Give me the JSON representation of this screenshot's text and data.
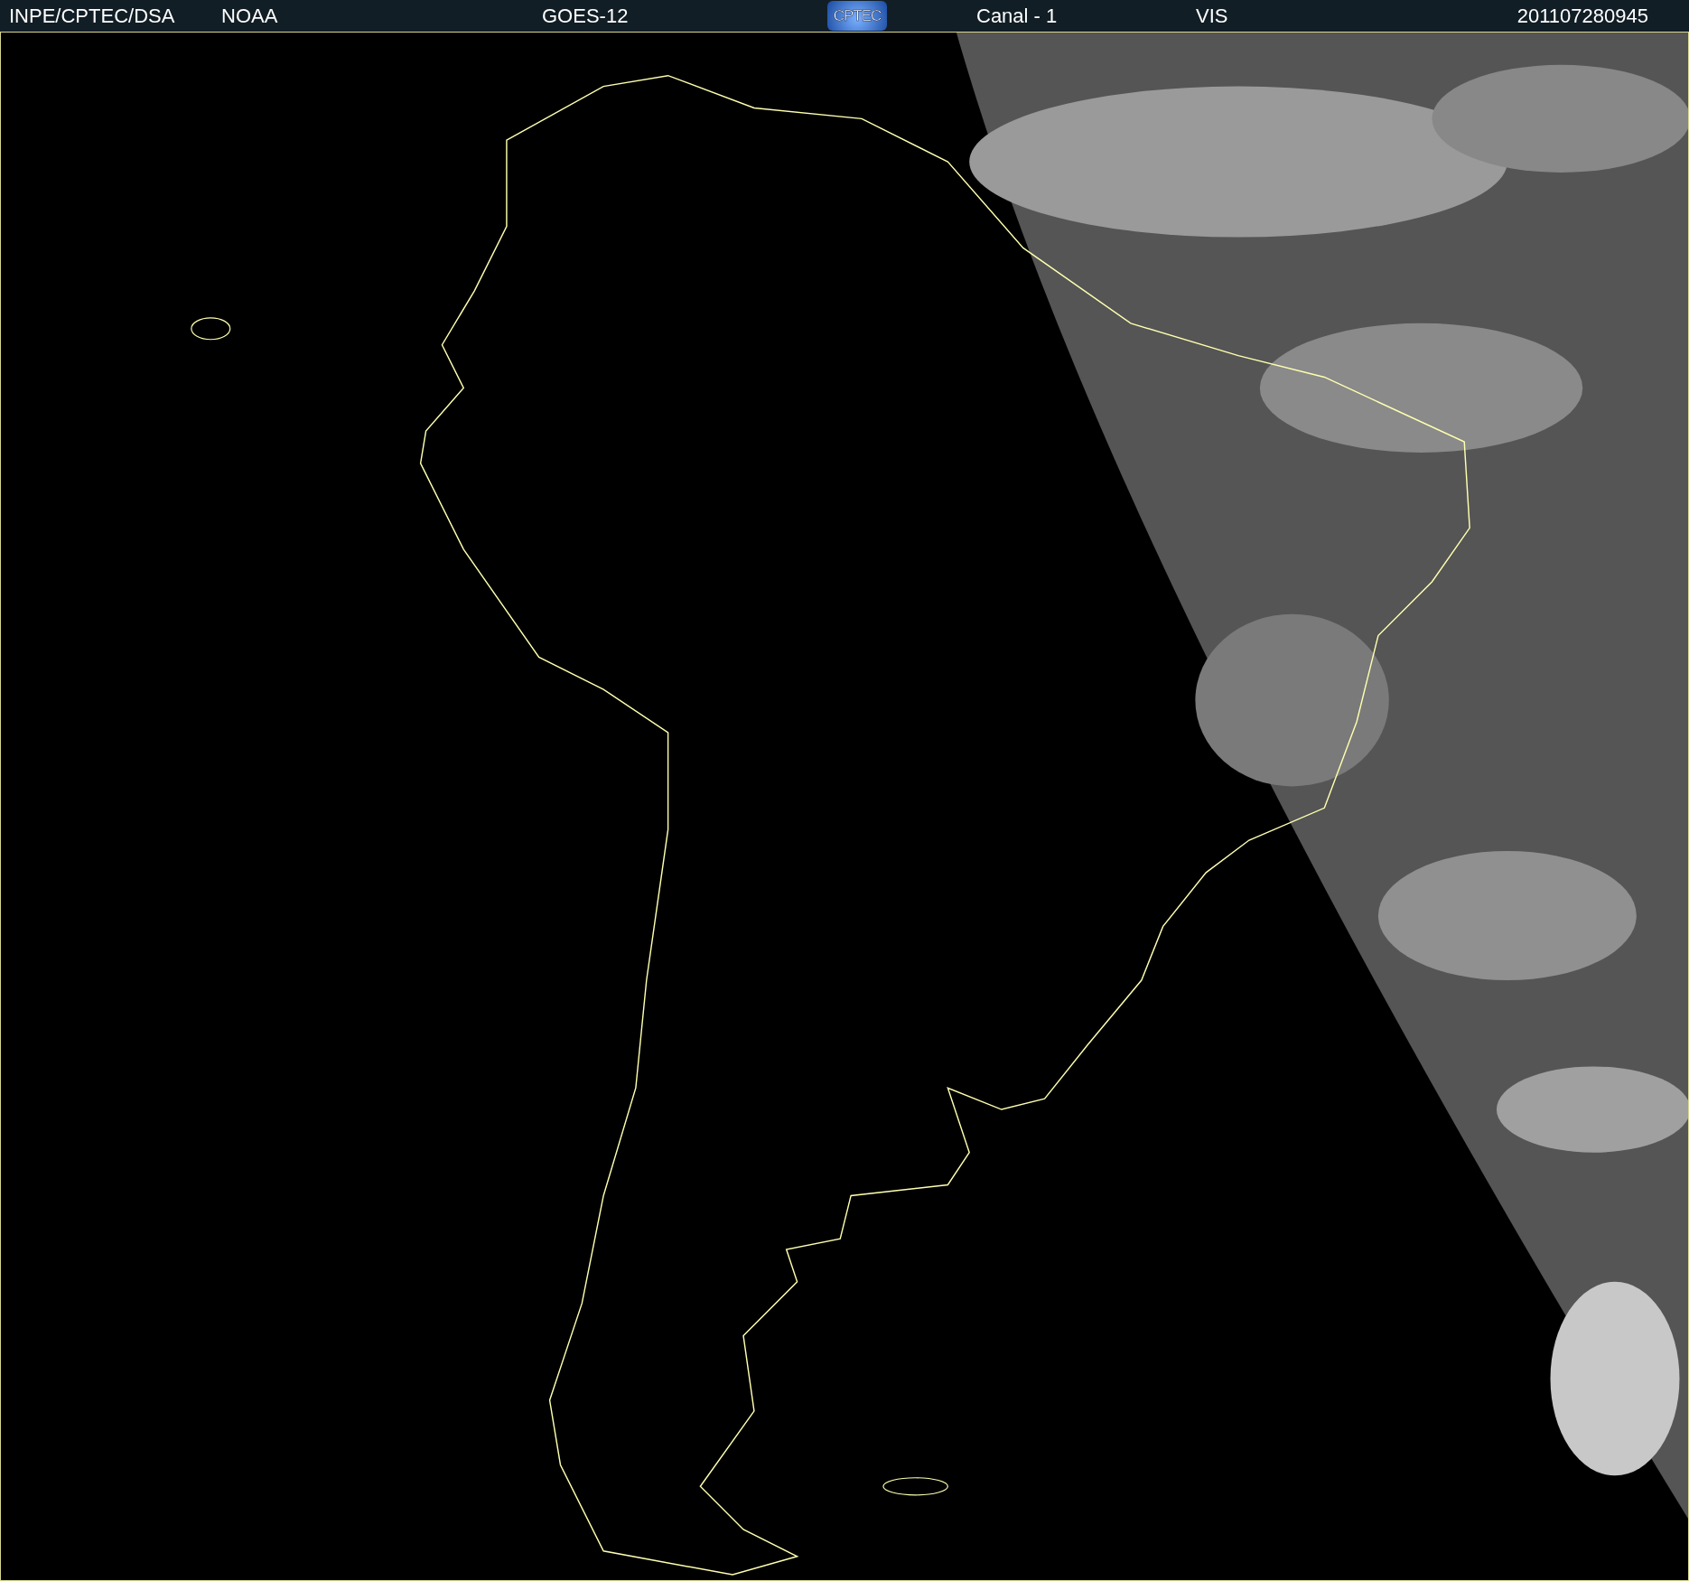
{
  "header": {
    "source": "INPE/CPTEC/DSA",
    "agency": "NOAA",
    "satellite": "GOES-12",
    "logo": "CPTEC",
    "channel": "Canal - 1",
    "band": "VIS",
    "timestamp": "201107280945"
  }
}
